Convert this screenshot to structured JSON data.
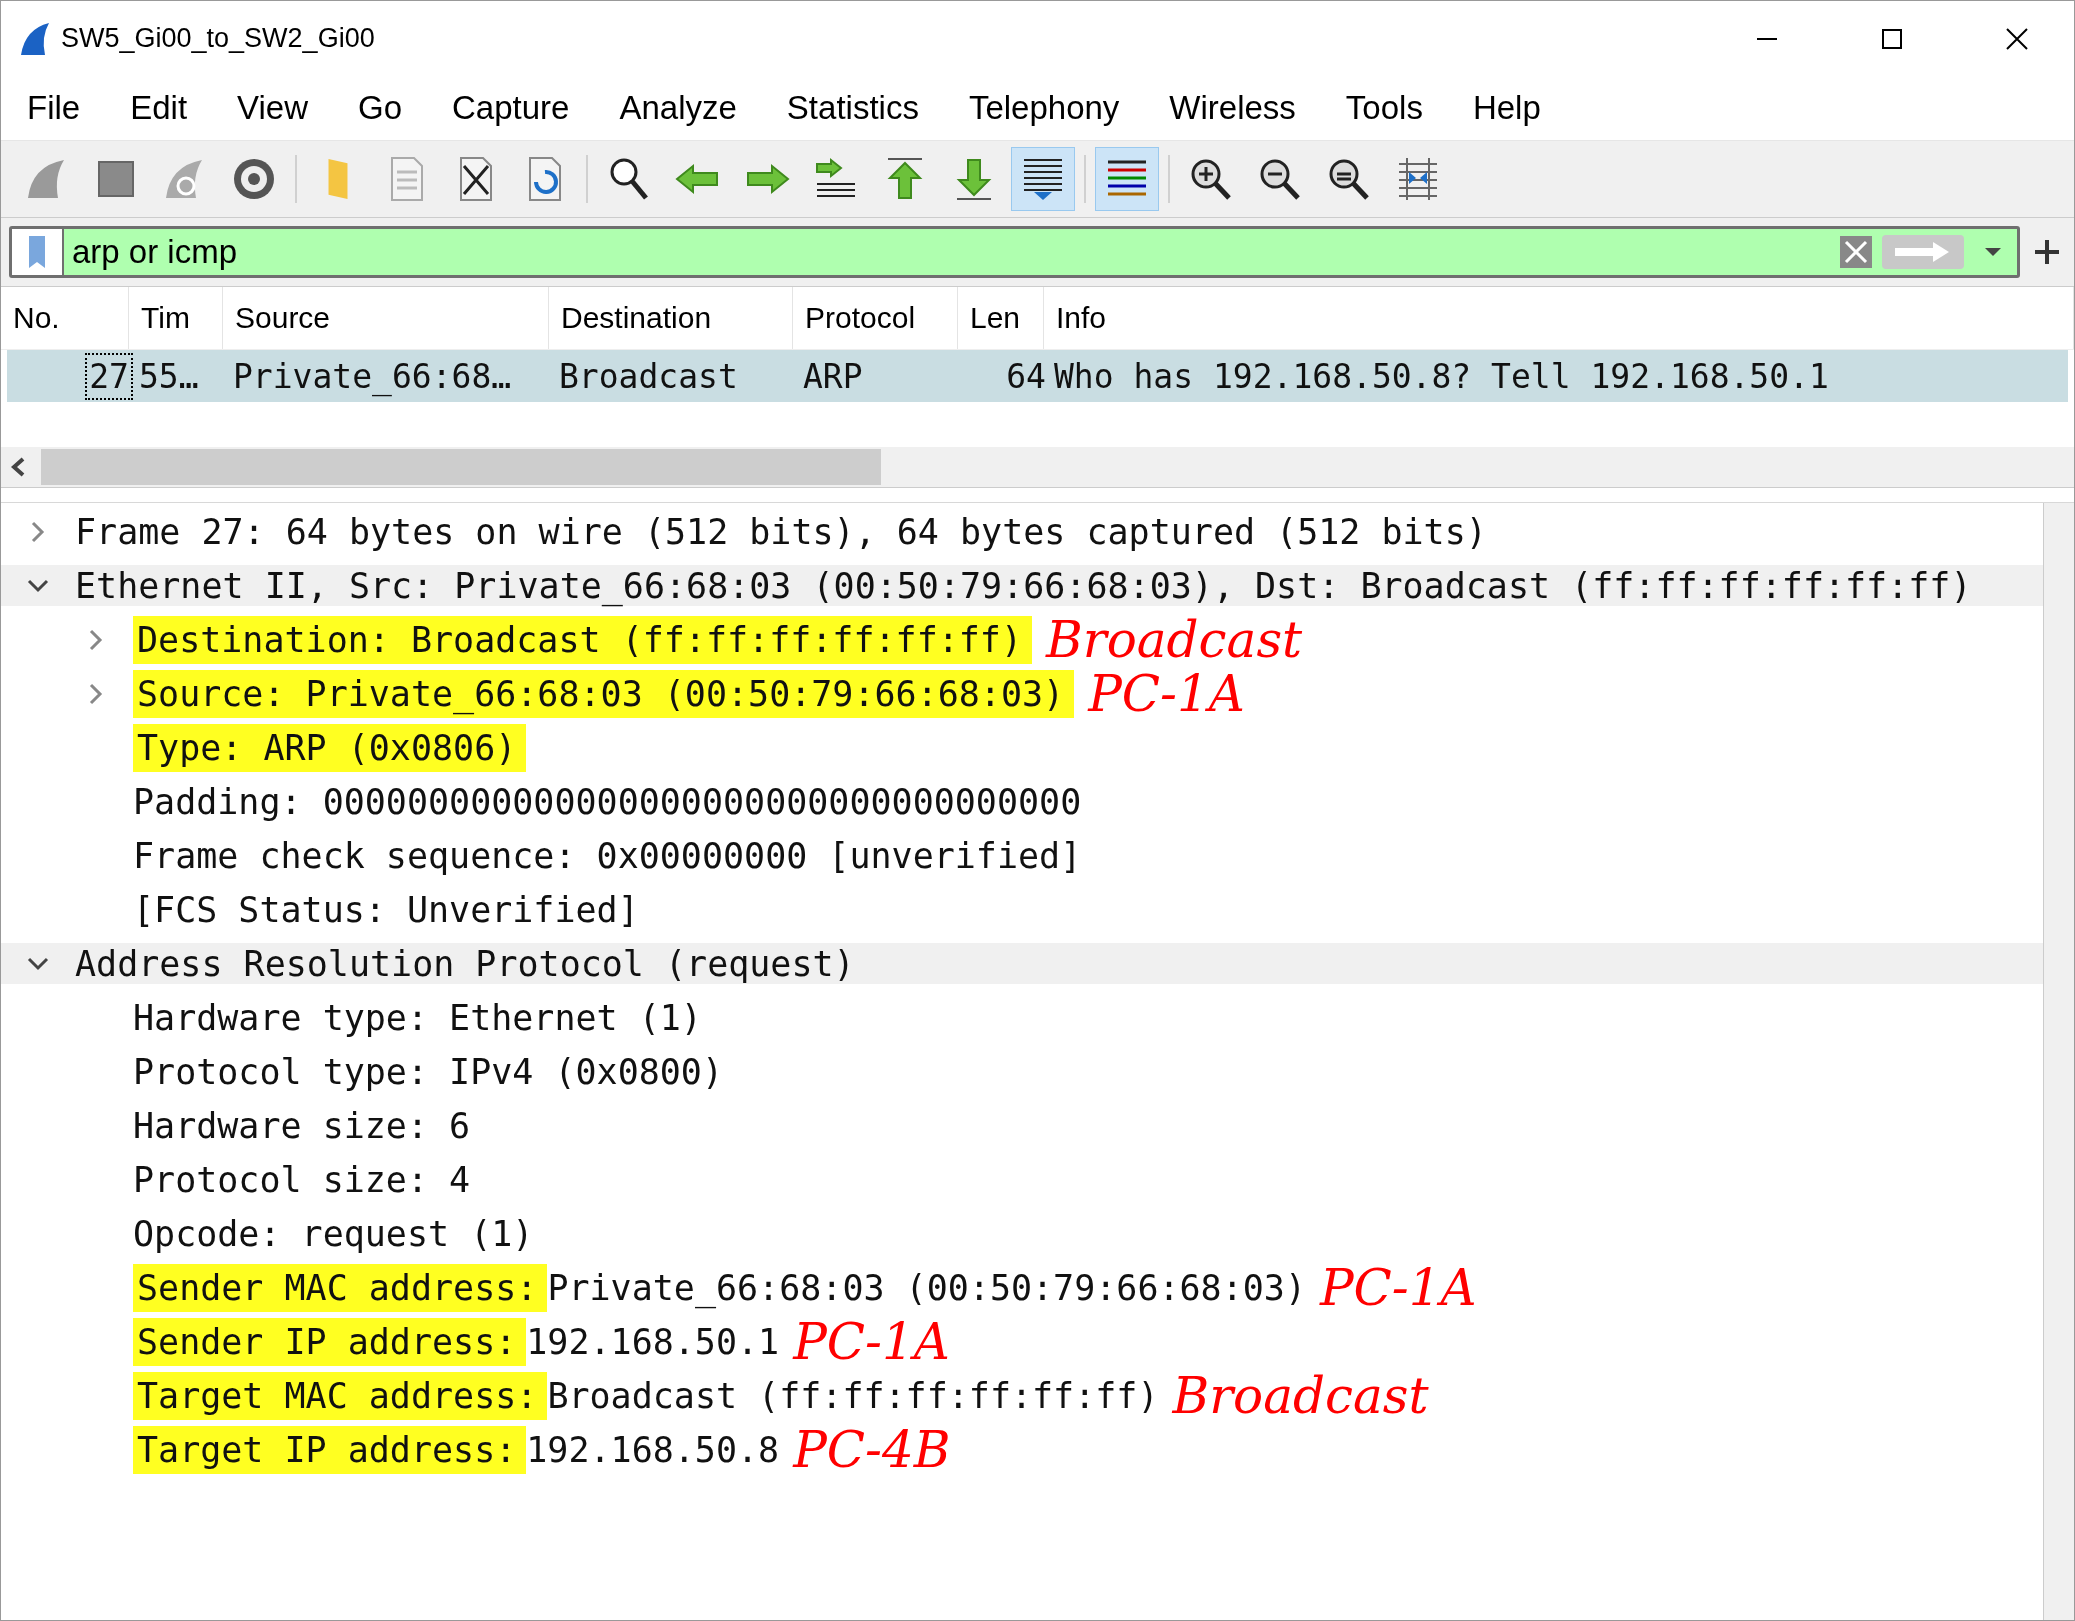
{
  "window": {
    "title": "SW5_Gi00_to_SW2_Gi00"
  },
  "menu": [
    "File",
    "Edit",
    "View",
    "Go",
    "Capture",
    "Analyze",
    "Statistics",
    "Telephony",
    "Wireless",
    "Tools",
    "Help"
  ],
  "toolbar": [
    [
      {
        "kind": "fin",
        "selected": false
      },
      {
        "kind": "stop",
        "selected": false
      },
      {
        "kind": "restart",
        "selected": false
      },
      {
        "kind": "options",
        "selected": false
      }
    ],
    [
      {
        "kind": "folder",
        "selected": false
      },
      {
        "kind": "file",
        "selected": false
      },
      {
        "kind": "closefile",
        "selected": false
      },
      {
        "kind": "reload",
        "selected": false
      }
    ],
    [
      {
        "kind": "find",
        "selected": false
      },
      {
        "kind": "back",
        "selected": false
      },
      {
        "kind": "forward",
        "selected": false
      },
      {
        "kind": "goto",
        "selected": false
      },
      {
        "kind": "first",
        "selected": false
      },
      {
        "kind": "last",
        "selected": false
      },
      {
        "kind": "autoscroll",
        "selected": true
      }
    ],
    [
      {
        "kind": "colorize",
        "selected": true
      }
    ],
    [
      {
        "kind": "zoomin",
        "selected": false
      },
      {
        "kind": "zoomout",
        "selected": false
      },
      {
        "kind": "zoomreset",
        "selected": false
      },
      {
        "kind": "resize",
        "selected": false
      }
    ]
  ],
  "filter": {
    "value": "arp or icmp"
  },
  "packet_list": {
    "columns": [
      "No.",
      "Tim",
      "Source",
      "Destination",
      "Protocol",
      "Len",
      "Info"
    ],
    "rows": [
      {
        "selected": true,
        "cells": [
          "27",
          "55…",
          "Private_66:68…",
          "Broadcast",
          "ARP",
          "64",
          "Who has 192.168.50.8? Tell 192.168.50.1"
        ]
      }
    ]
  },
  "details": [
    {
      "text": "Frame 27: 64 bytes on wire (512 bits), 64 bytes captured (512 bits)",
      "expanded": false
    },
    {
      "text": "Ethernet II, Src: Private_66:68:03 (00:50:79:66:68:03), Dst: Broadcast (ff:ff:ff:ff:ff:ff)",
      "expanded": true,
      "children": [
        {
          "marked": "Destination: Broadcast (ff:ff:ff:ff:ff:ff)",
          "note": "Broadcast",
          "expanded": false
        },
        {
          "marked": "Source: Private_66:68:03 (00:50:79:66:68:03)",
          "note": "PC-1A",
          "expanded": false
        },
        {
          "marked": "Type: ARP (0x0806)"
        },
        {
          "text": "Padding: 000000000000000000000000000000000000"
        },
        {
          "text": "Frame check sequence: 0x00000000 [unverified]"
        },
        {
          "text": "[FCS Status: Unverified]"
        }
      ]
    },
    {
      "text": "Address Resolution Protocol (request)",
      "expanded": true,
      "children": [
        {
          "text": "Hardware type: Ethernet (1)"
        },
        {
          "text": "Protocol type: IPv4 (0x0800)"
        },
        {
          "text": "Hardware size: 6"
        },
        {
          "text": "Protocol size: 4"
        },
        {
          "text": "Opcode: request (1)"
        },
        {
          "marked": "Sender MAC address: ",
          "text": "Private_66:68:03 (00:50:79:66:68:03)",
          "note": "PC-1A"
        },
        {
          "marked": "Sender IP address: ",
          "text": "192.168.50.1",
          "note": "PC-1A"
        },
        {
          "marked": "Target MAC address: ",
          "text": "Broadcast (ff:ff:ff:ff:ff:ff)",
          "note": "Broadcast"
        },
        {
          "marked": "Target IP address: ",
          "text": "192.168.50.8",
          "note": "PC-4B"
        }
      ]
    }
  ]
}
